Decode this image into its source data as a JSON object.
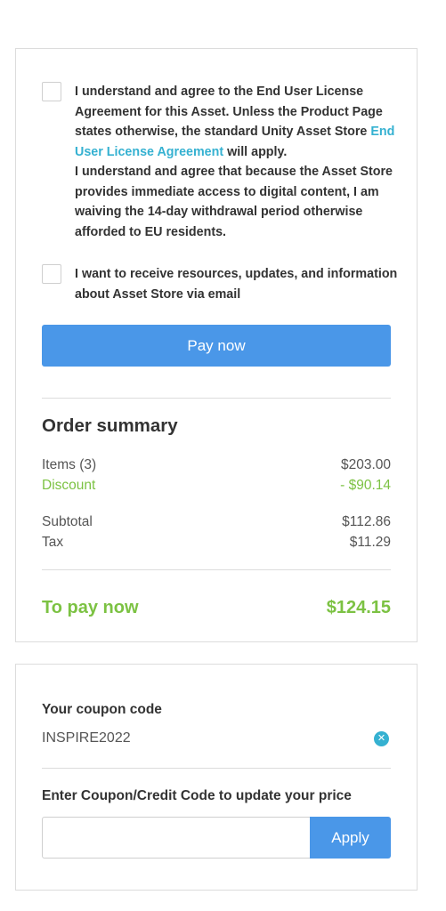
{
  "agreements": {
    "license_text_1": "I understand and agree to the End User License Agreement for this Asset. Unless the Product Page states otherwise, the standard Unity Asset Store ",
    "license_link": "End User License Agreement",
    "license_text_2": " will apply.",
    "withdrawal_text": "I understand and agree that because the Asset Store provides immediate access to digital content, I am waiving the 14-day withdrawal period otherwise afforded to EU residents.",
    "newsletter_text": "I want to receive resources, updates, and information about Asset Store via email"
  },
  "pay_button": "Pay now",
  "order_summary": {
    "title": "Order summary",
    "items_label": "Items (3)",
    "items_value": "$203.00",
    "discount_label": "Discount",
    "discount_value": "- $90.14",
    "subtotal_label": "Subtotal",
    "subtotal_value": "$112.86",
    "tax_label": "Tax",
    "tax_value": "$11.29",
    "total_label": "To pay now",
    "total_value": "$124.15"
  },
  "coupon": {
    "heading": "Your coupon code",
    "code": "INSPIRE2022",
    "update_label": "Enter Coupon/Credit Code to update your price",
    "input_value": "",
    "apply_button": "Apply"
  },
  "colors": {
    "primary_button": "#4a97e8",
    "link": "#35b1d1",
    "accent_green": "#7cc243"
  },
  "icons": {
    "clear_coupon": "close-circle-icon"
  }
}
